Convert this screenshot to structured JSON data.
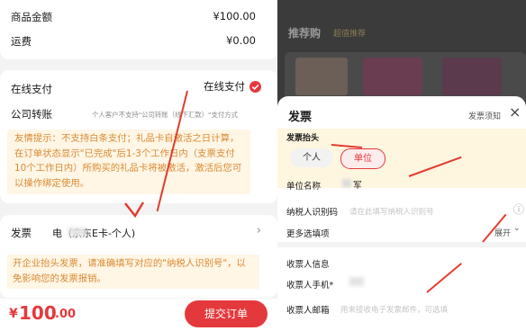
{
  "left": {
    "goods_label": "商品金额",
    "goods_value": "¥100.00",
    "shipping_label": "运费",
    "shipping_value": "¥0.00",
    "online_pay_label": "在线支付",
    "online_pay_value": "在线支付",
    "transfer_label": "公司转账",
    "transfer_desc": "个人客户不支持\"公司转账（线下汇款）\"支付方式",
    "tip_text": "友情提示：不支持白条支付；礼品卡自激活之日计算，在订单状态显示\"已完成\"后1-3个工作日内（支票支付10个工作日内）所购买的礼品卡将被激活，激活后您可以操作绑定使用。",
    "invoice_label": "发票",
    "invoice_value": "电（京东E卡-个人)",
    "invoice_tip": "开企业抬头发票，请准确填写对应的\"纳税人识别号\"，以免影响您的发票报销。",
    "total_prefix": "¥",
    "total_int": "100",
    "total_dec": ".00",
    "submit_label": "提交订单"
  },
  "right": {
    "banner_title": "推荐购",
    "banner_sub": "超值推荐",
    "sheet_title": "发票",
    "notice_link": "发票须知",
    "close": "×",
    "header_label": "发票抬头",
    "opt_personal": "个人",
    "opt_company": "单位",
    "company_name_label": "单位名称",
    "company_name_value": "军",
    "tax_id_label": "纳税人识别码",
    "tax_id_placeholder": "请在此填写纳税人识别号",
    "more_label": "更多选填项",
    "more_action": "展开",
    "receiver_section": "收票人信息",
    "receiver_phone_label": "收票人手机*",
    "receiver_email_label": "收票人邮箱",
    "receiver_email_placeholder": "用来接收电子发票邮件，可选填"
  },
  "colors": {
    "accent": "#e4393c",
    "tip_text": "#d98a34",
    "tip_bg": "#fff6e5"
  }
}
